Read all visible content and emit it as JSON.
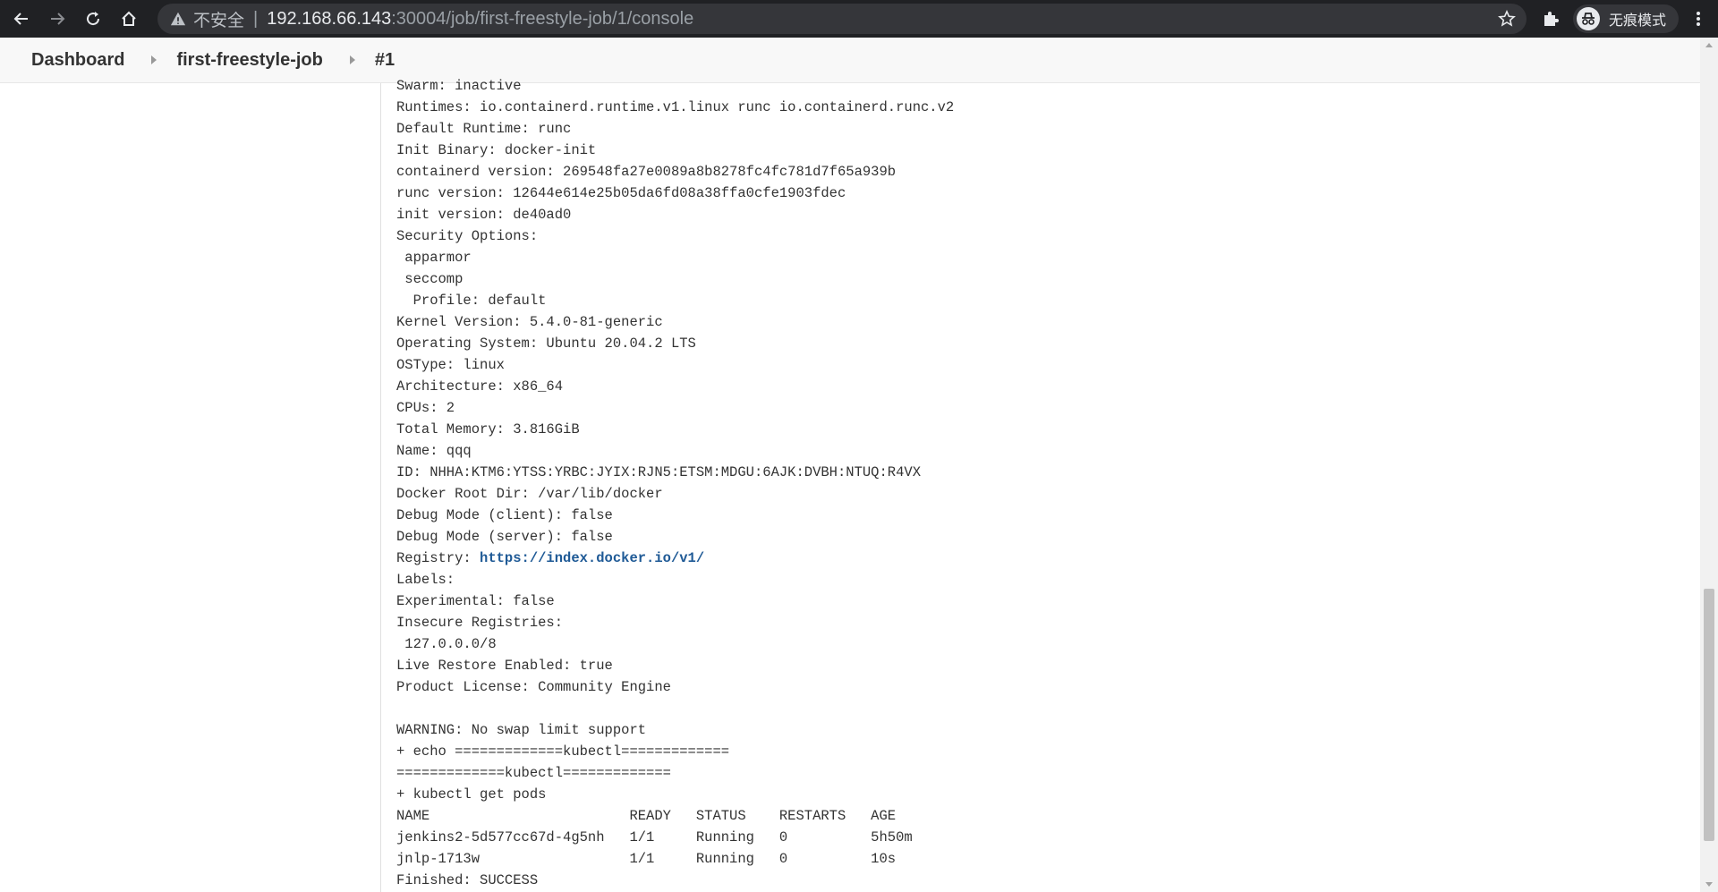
{
  "browser": {
    "insecure_label": "不安全",
    "url_host": "192.168.66.143",
    "url_path": ":30004/job/first-freestyle-job/1/console",
    "profile_label": "无痕模式"
  },
  "breadcrumb": {
    "items": [
      "Dashboard",
      "first-freestyle-job",
      "#1"
    ]
  },
  "console": {
    "lines": [
      "Swarm: inactive",
      "Runtimes: io.containerd.runtime.v1.linux runc io.containerd.runc.v2",
      "Default Runtime: runc",
      "Init Binary: docker-init",
      "containerd version: 269548fa27e0089a8b8278fc4fc781d7f65a939b",
      "runc version: 12644e614e25b05da6fd08a38ffa0cfe1903fdec",
      "init version: de40ad0",
      "Security Options:",
      " apparmor",
      " seccomp",
      "  Profile: default",
      "Kernel Version: 5.4.0-81-generic",
      "Operating System: Ubuntu 20.04.2 LTS",
      "OSType: linux",
      "Architecture: x86_64",
      "CPUs: 2",
      "Total Memory: 3.816GiB",
      "Name: qqq",
      "ID: NHHA:KTM6:YTSS:YRBC:JYIX:RJN5:ETSM:MDGU:6AJK:DVBH:NTUQ:R4VX",
      "Docker Root Dir: /var/lib/docker",
      "Debug Mode (client): false",
      "Debug Mode (server): false",
      "Registry: ",
      "Labels:",
      "Experimental: false",
      "Insecure Registries:",
      " 127.0.0.0/8",
      "Live Restore Enabled: true",
      "Product License: Community Engine",
      "",
      "WARNING: No swap limit support",
      "+ echo =============kubectl=============",
      "=============kubectl=============",
      "+ kubectl get pods",
      "NAME                        READY   STATUS    RESTARTS   AGE",
      "jenkins2-5d577cc67d-4g5nh   1/1     Running   0          5h50m",
      "jnlp-1713w                  1/1     Running   0          10s",
      "Finished: SUCCESS"
    ],
    "registry_link": "https://index.docker.io/v1/"
  }
}
